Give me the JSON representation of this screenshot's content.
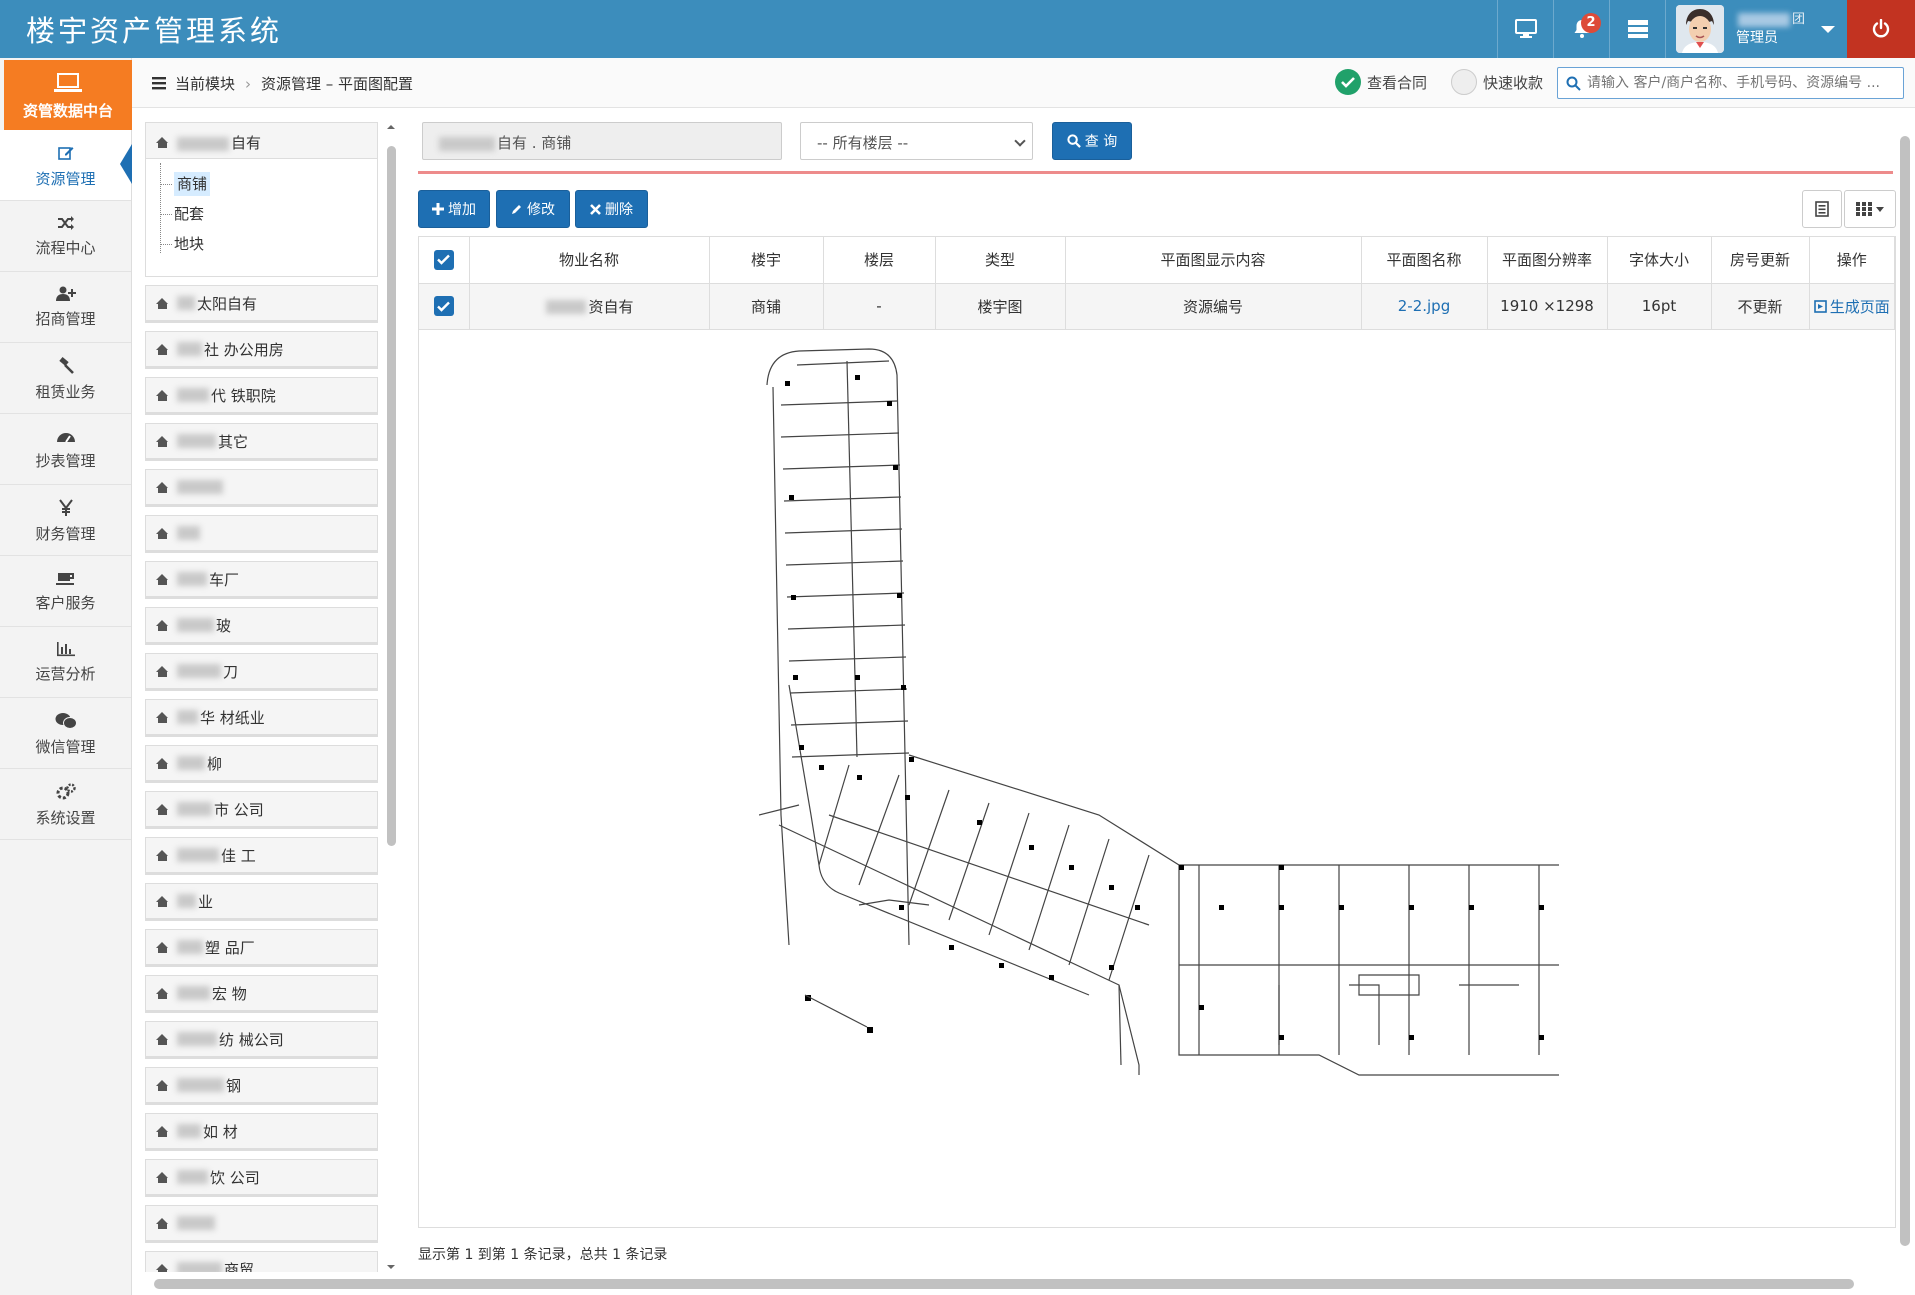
{
  "header": {
    "title": "楼宇资产管理系统",
    "notification_count": "2",
    "user_name": "团",
    "user_role": "管理员"
  },
  "nav": {
    "home_label": "资管数据中台",
    "items": [
      {
        "label": "资源管理",
        "icon": "edit-icon"
      },
      {
        "label": "流程中心",
        "icon": "shuffle-icon"
      },
      {
        "label": "招商管理",
        "icon": "user-plus-icon"
      },
      {
        "label": "租赁业务",
        "icon": "gavel-icon"
      },
      {
        "label": "抄表管理",
        "icon": "dashboard-icon"
      },
      {
        "label": "财务管理",
        "icon": "yen-icon"
      },
      {
        "label": "客户服务",
        "icon": "coffee-icon"
      },
      {
        "label": "运营分析",
        "icon": "bar-chart-icon"
      },
      {
        "label": "微信管理",
        "icon": "wechat-icon"
      },
      {
        "label": "系统设置",
        "icon": "cogs-icon"
      }
    ]
  },
  "breadcrumb": {
    "root": "当前模块",
    "path": "资源管理 – 平面图配置"
  },
  "toolbar_top": {
    "view_contract": "查看合同",
    "quick_collect": "快速收款",
    "search_placeholder": "请输入 客户/商户名称、手机号码、资源编号 ..."
  },
  "tree": {
    "root": "自有",
    "children": [
      "商铺",
      "配套",
      "地块"
    ],
    "selected_child": "商铺",
    "nodes": [
      "太阳自有",
      "社 办公用房",
      "代 铁职院",
      "其它",
      "",
      "",
      "车厂",
      "玻",
      "刀",
      "华 材纸业",
      "柳",
      "市 公司",
      "佳 工",
      "业",
      "塑 品厂",
      "宏 物",
      "纺 械公司",
      "钢",
      "如 材",
      "饮 公司",
      "",
      "商贸"
    ]
  },
  "filters": {
    "building_text": "自有 . 商铺",
    "floor_selected": "-- 所有楼层 --",
    "query_label": "查 询"
  },
  "actions": {
    "add": "增加",
    "edit": "修改",
    "delete": "删除"
  },
  "table": {
    "headers": [
      "物业名称",
      "楼宇",
      "楼层",
      "类型",
      "平面图显示内容",
      "平面图名称",
      "平面图分辨率",
      "字体大小",
      "房号更新",
      "操作"
    ],
    "rows": [
      {
        "property": "资自有",
        "building": "商铺",
        "floor": "-",
        "type": "楼宇图",
        "display": "资源编号",
        "image_name": "2-2.jpg",
        "resolution": "1910 ×1298",
        "font_size": "16pt",
        "room_update": "不更新",
        "action": "生成页面"
      }
    ]
  },
  "footer": {
    "info": "显示第 1 到第 1 条记录，总共 1 条记录"
  },
  "colors": {
    "header_bg": "#3c8dbc",
    "brand_orange": "#f57c22",
    "primary": "#1e6fb3",
    "power_red": "#c23321"
  }
}
